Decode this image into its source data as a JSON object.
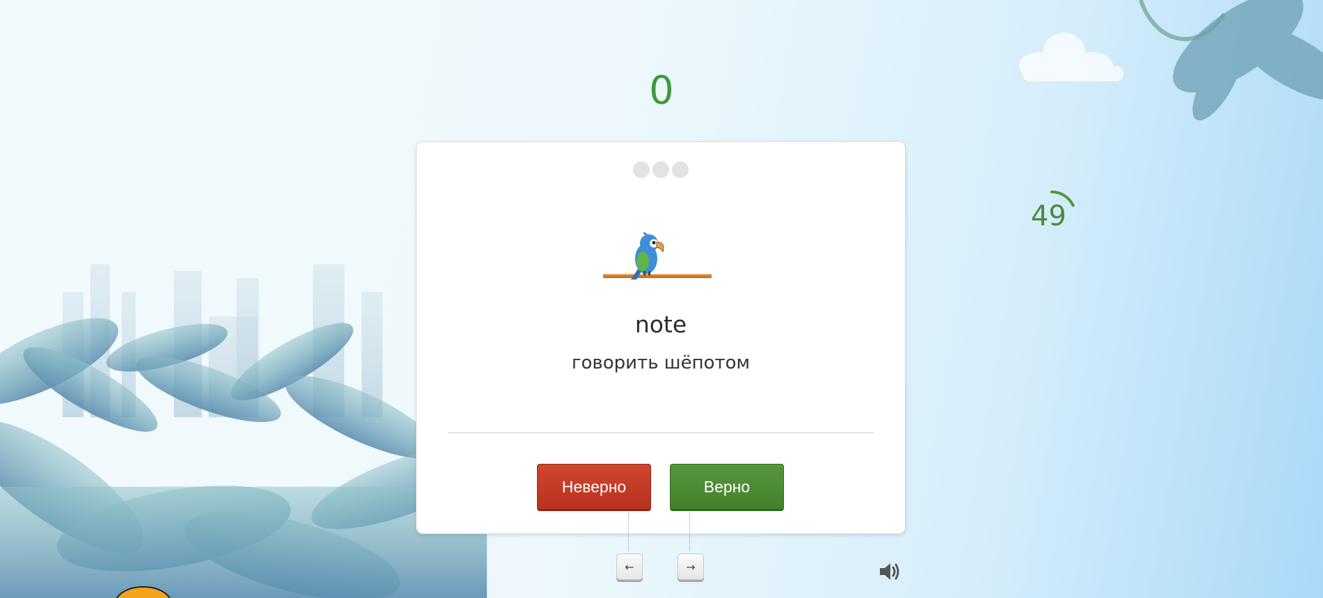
{
  "score": "0",
  "timer": {
    "seconds_left": "49",
    "progress": 0.18
  },
  "card": {
    "word": "note",
    "translation": "говорить шёпотом",
    "dots_count": 3
  },
  "buttons": {
    "wrong_label": "Неверно",
    "right_label": "Верно"
  },
  "keys": {
    "left_key": "←",
    "right_key": "→"
  },
  "icons": {
    "parrot": "parrot-icon",
    "sound": "speaker-icon"
  },
  "colors": {
    "score": "#3d9a3b",
    "wrong": "#c23b26",
    "right": "#4c8a36",
    "timer": "#4c8a3e"
  }
}
